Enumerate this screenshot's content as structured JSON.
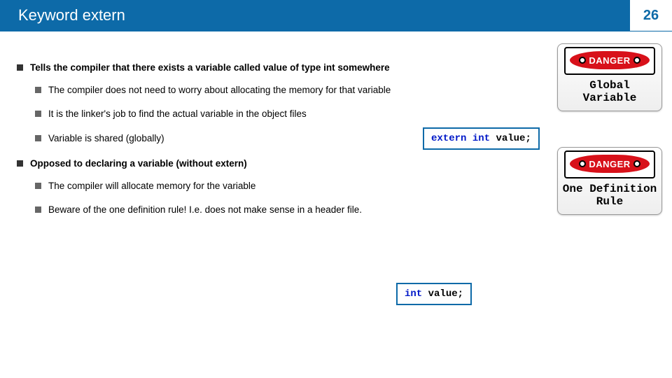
{
  "header": {
    "title": "Keyword extern",
    "page_number": "26"
  },
  "bullets": {
    "top1": "Tells the compiler that there exists a variable called value of type int somewhere",
    "sub1": "The compiler does not need to worry about allocating the memory for that variable",
    "sub2": "It is the linker's job to find the actual variable in the object files",
    "sub3": "Variable is shared (globally)",
    "top2": "Opposed to declaring a variable (without extern)",
    "sub4": "The compiler will allocate memory for the variable",
    "sub5": "Beware of the one definition rule! I.e. does not make sense in a header file."
  },
  "code": {
    "extern_kw": "extern",
    "int_kw": "int",
    "int_kw2": "int",
    "ident": " value;",
    "ident2": " value;"
  },
  "danger": {
    "sign_word": "DANGER",
    "card1_line1": "Global",
    "card1_line2": "Variable",
    "card2_line1": "One Definition",
    "card2_line2": "Rule"
  }
}
